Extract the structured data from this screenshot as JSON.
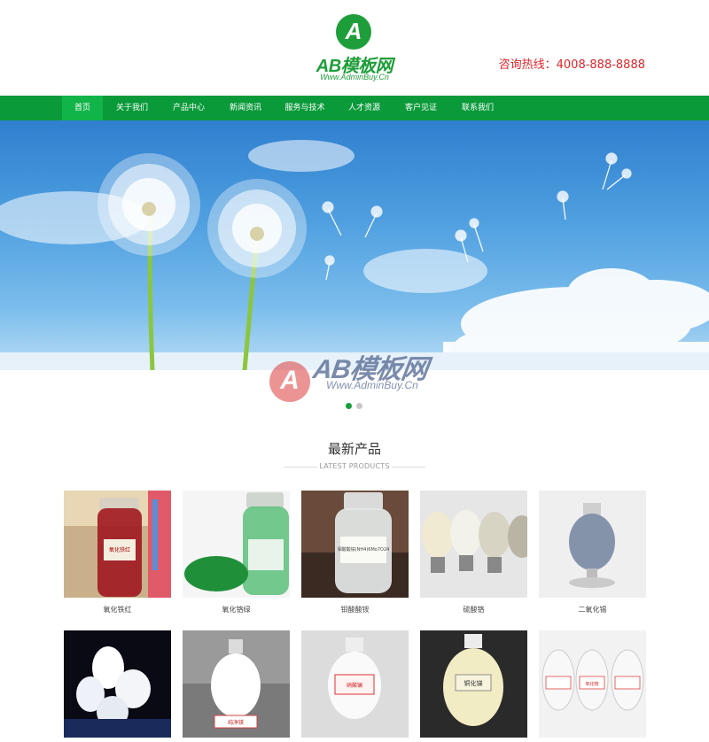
{
  "header": {
    "logo_letter": "A",
    "logo_name": "AB模板网",
    "logo_url": "Www.AdminBuy.Cn",
    "hotline": "咨询热线：4008-888-8888"
  },
  "nav": {
    "items": [
      "首页",
      "关于我们",
      "产品中心",
      "新闻资讯",
      "服务与技术",
      "人才资源",
      "客户见证",
      "联系我们"
    ]
  },
  "banner": {
    "watermark_name": "AB模板网",
    "watermark_url": "Www.AdminBuy.Cn",
    "slide_count": 2,
    "active_slide": 1
  },
  "section": {
    "title": "最新产品",
    "subtitle": "LATEST PRODUCTS"
  },
  "products": [
    {
      "name": "氧化铁红",
      "label": "氧化铁红"
    },
    {
      "name": "氧化铬绿",
      "label": ""
    },
    {
      "name": "钼酸酸铵",
      "label": "钼酸酸铵(NH4)6Mo7O24"
    },
    {
      "name": "硫酸铬",
      "label": ""
    },
    {
      "name": "二氧化锡",
      "label": ""
    },
    {
      "name": "",
      "label": ""
    },
    {
      "name": "",
      "label": "纯净镁"
    },
    {
      "name": "",
      "label": "硝酸镧"
    },
    {
      "name": "",
      "label": "铜化锑"
    },
    {
      "name": "",
      "label": "氧化物"
    }
  ],
  "colors": {
    "brand_green": "#0a9a3a",
    "nav_active": "#10b449",
    "hotline_red": "#e0242a"
  }
}
